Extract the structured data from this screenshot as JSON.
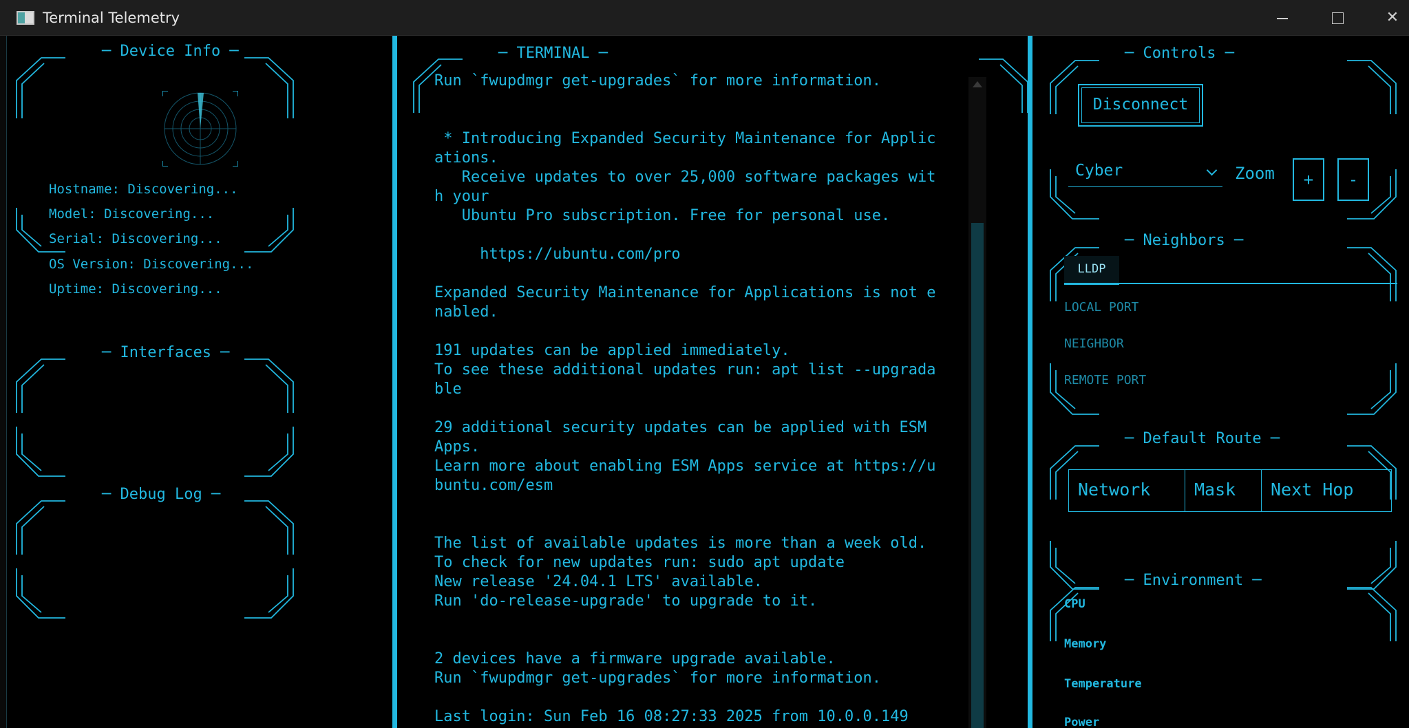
{
  "window": {
    "title": "Terminal Telemetry"
  },
  "colors": {
    "accent": "#22b8e0",
    "background": "#000000",
    "titlebar": "#1e1e1e"
  },
  "left_panel": {
    "device_info": {
      "title": "─ Device Info ─",
      "fields": [
        "Hostname: Discovering...",
        "Model: Discovering...",
        "Serial: Discovering...",
        "OS Version: Discovering...",
        "Uptime: Discovering..."
      ]
    },
    "interfaces": {
      "title": "─ Interfaces ─"
    },
    "debug_log": {
      "title": "─ Debug Log ─"
    }
  },
  "terminal": {
    "title": "─ TERMINAL ─",
    "lines": [
      "Run `fwupdmgr get-upgrades` for more information.",
      "",
      "",
      " * Introducing Expanded Security Maintenance for Applic",
      "ations.",
      "   Receive updates to over 25,000 software packages wit",
      "h your",
      "   Ubuntu Pro subscription. Free for personal use.",
      "",
      "     https://ubuntu.com/pro",
      "",
      "Expanded Security Maintenance for Applications is not e",
      "nabled.",
      "",
      "191 updates can be applied immediately.",
      "To see these additional updates run: apt list --upgrada",
      "ble",
      "",
      "29 additional security updates can be applied with ESM",
      "Apps.",
      "Learn more about enabling ESM Apps service at https://u",
      "buntu.com/esm",
      "",
      "",
      "The list of available updates is more than a week old.",
      "To check for new updates run: sudo apt update",
      "New release '24.04.1 LTS' available.",
      "Run 'do-release-upgrade' to upgrade to it.",
      "",
      "",
      "2 devices have a firmware upgrade available.",
      "Run `fwupdmgr get-upgrades` for more information.",
      "",
      "Last login: Sun Feb 16 08:27:33 2025 from 10.0.0.149"
    ]
  },
  "right_panel": {
    "controls": {
      "title": "─ Controls ─",
      "disconnect_label": "Disconnect",
      "theme_selected": "Cyber",
      "zoom_label": "Zoom",
      "zoom_in": "+",
      "zoom_out": "-"
    },
    "neighbors": {
      "title": "─ Neighbors ─",
      "tab": "LLDP",
      "columns": [
        "LOCAL PORT",
        "NEIGHBOR",
        "REMOTE PORT"
      ]
    },
    "default_route": {
      "title": "─ Default Route ─",
      "columns": [
        "Network",
        "Mask",
        "Next Hop"
      ]
    },
    "environment": {
      "title": "─ Environment ─",
      "items": [
        "CPU",
        "Memory",
        "Temperature",
        "Power"
      ]
    }
  },
  "icons": {
    "app": "terminal-app-icon",
    "radar": "radar-icon",
    "minimize": "minimize-icon",
    "maximize": "maximize-icon",
    "close": "close-icon",
    "select_chevron": "chevron-down-icon"
  }
}
